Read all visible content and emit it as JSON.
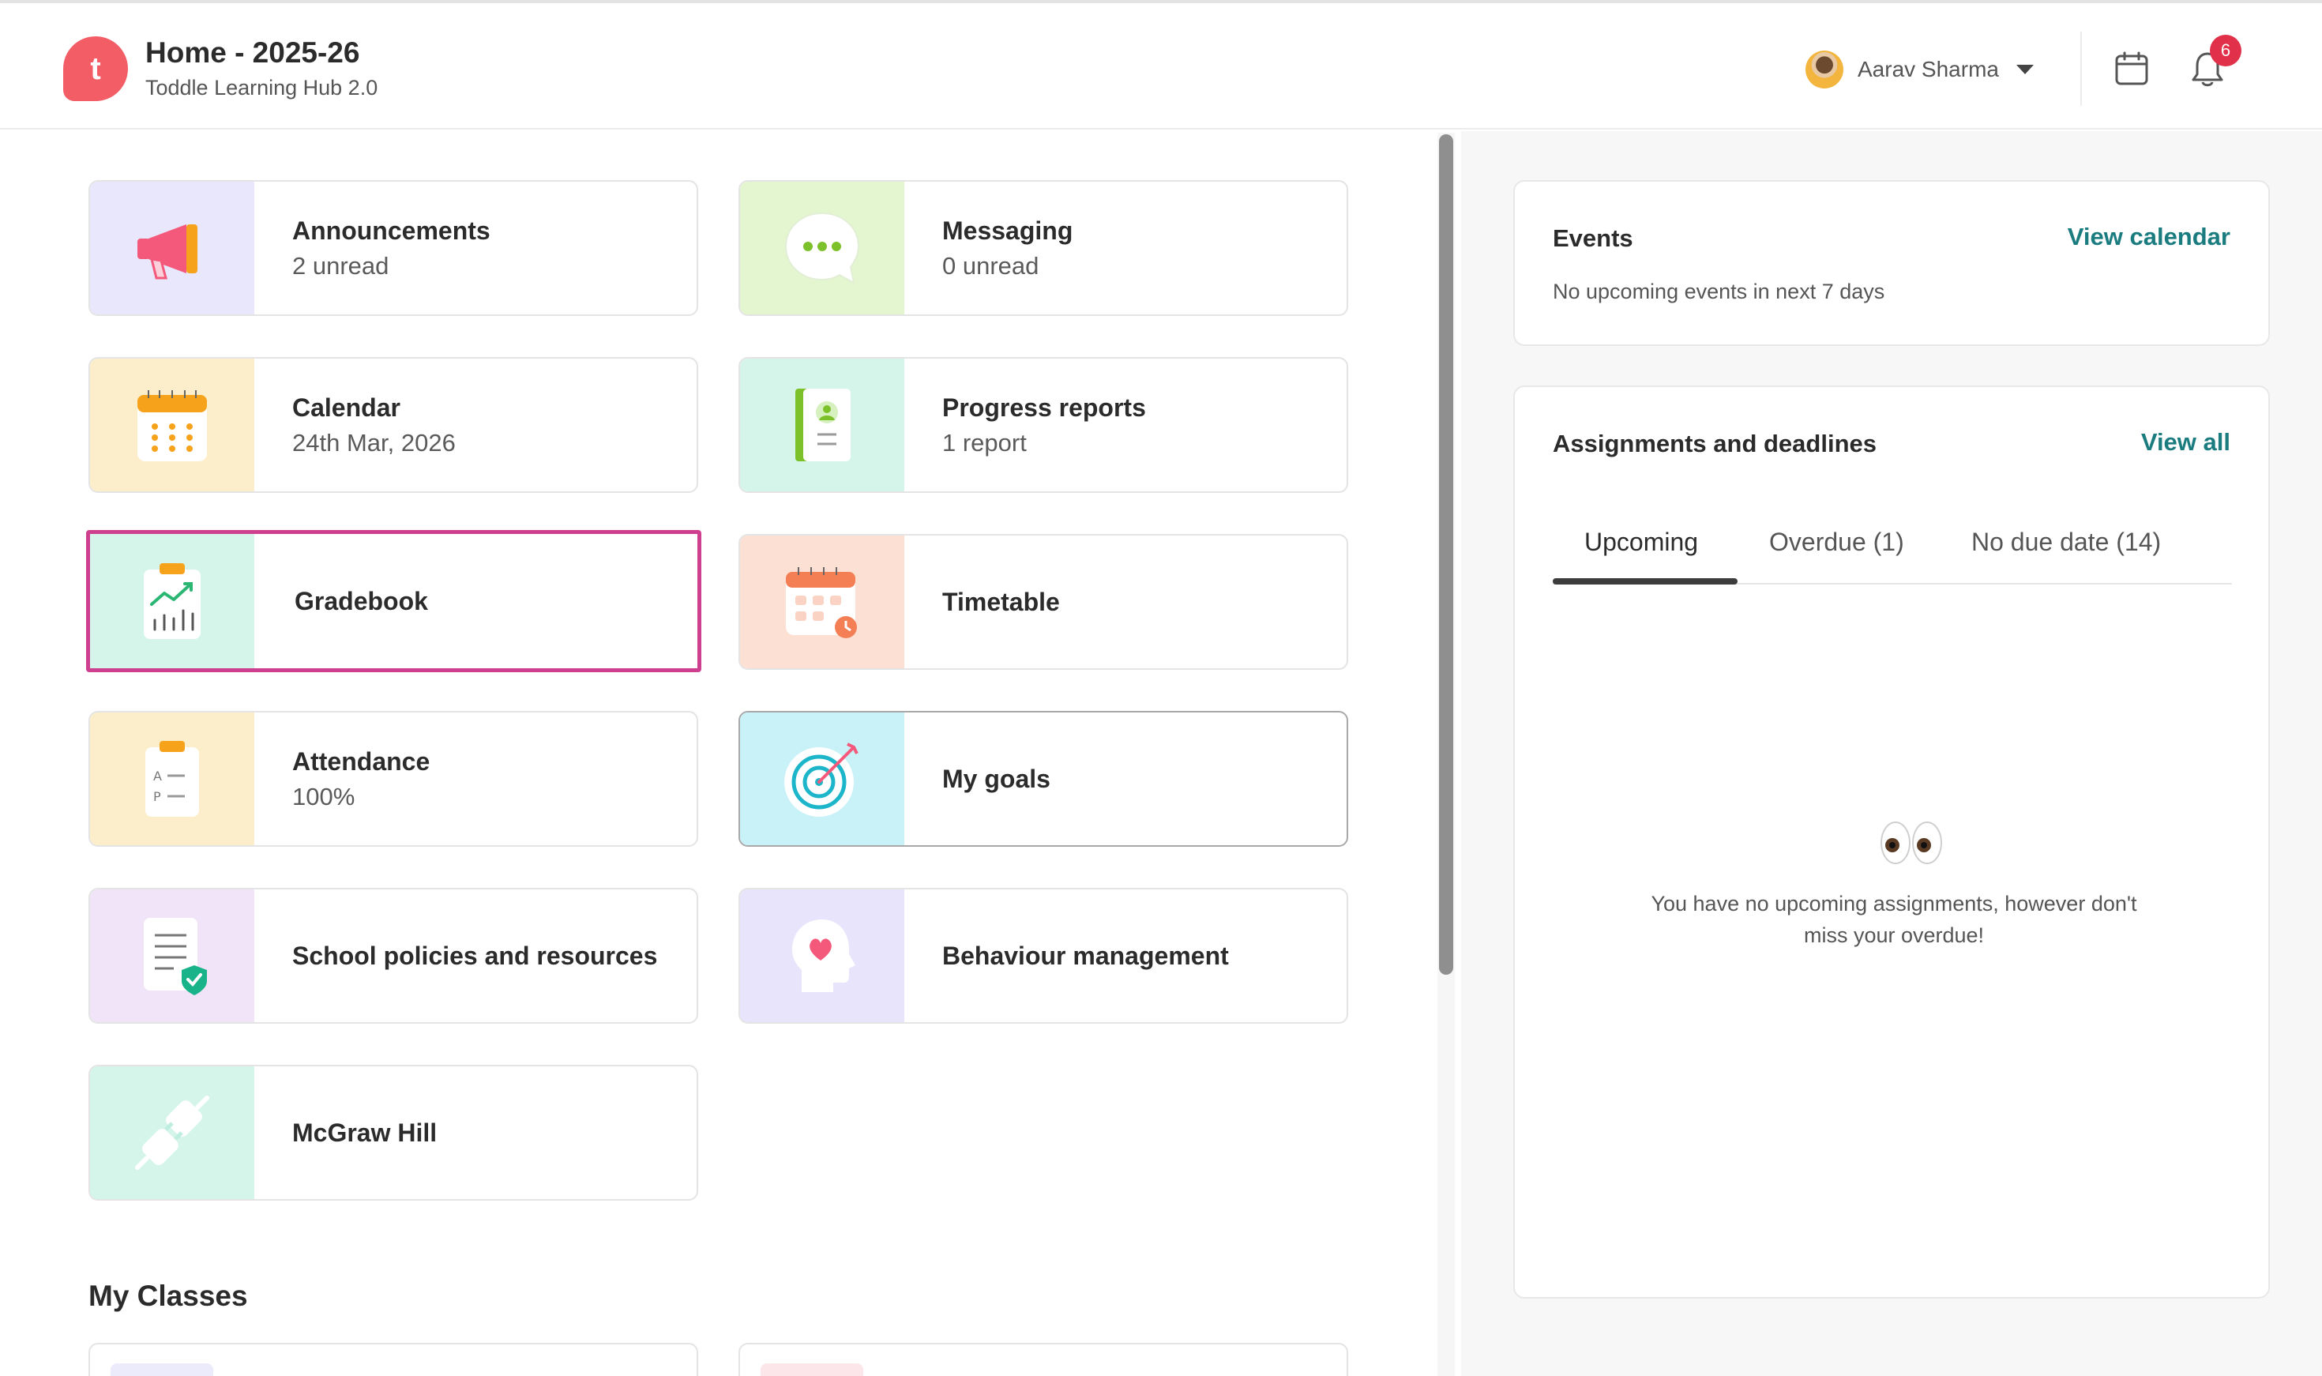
{
  "header": {
    "logo_letter": "t",
    "title": "Home - 2025-26",
    "subtitle": "Toddle Learning Hub 2.0",
    "user_name": "Aarav Sharma",
    "notification_count": "6"
  },
  "tiles": [
    {
      "title": "Announcements",
      "subtitle": "2 unread"
    },
    {
      "title": "Messaging",
      "subtitle": "0 unread"
    },
    {
      "title": "Calendar",
      "subtitle": "24th Mar, 2026"
    },
    {
      "title": "Progress reports",
      "subtitle": "1 report"
    },
    {
      "title": "Gradebook"
    },
    {
      "title": "Timetable"
    },
    {
      "title": "Attendance",
      "subtitle": "100%"
    },
    {
      "title": "My goals"
    },
    {
      "title": "School policies and resources"
    },
    {
      "title": "Behaviour management"
    },
    {
      "title": "McGraw Hill"
    }
  ],
  "my_classes_title": "My Classes",
  "events": {
    "title": "Events",
    "link": "View calendar",
    "empty": "No upcoming events in next 7 days"
  },
  "assignments": {
    "title": "Assignments and deadlines",
    "link": "View all",
    "tabs": [
      "Upcoming",
      "Overdue (1)",
      "No due date (14)"
    ],
    "active_tab": "Upcoming",
    "empty_line1": "You have no upcoming assignments, however don't",
    "empty_line2": "miss your overdue!"
  },
  "colors": {
    "brand": "#f25d66",
    "link": "#1b7c80",
    "selected_outline": "#cf3f8f",
    "badge": "#e0304a"
  }
}
